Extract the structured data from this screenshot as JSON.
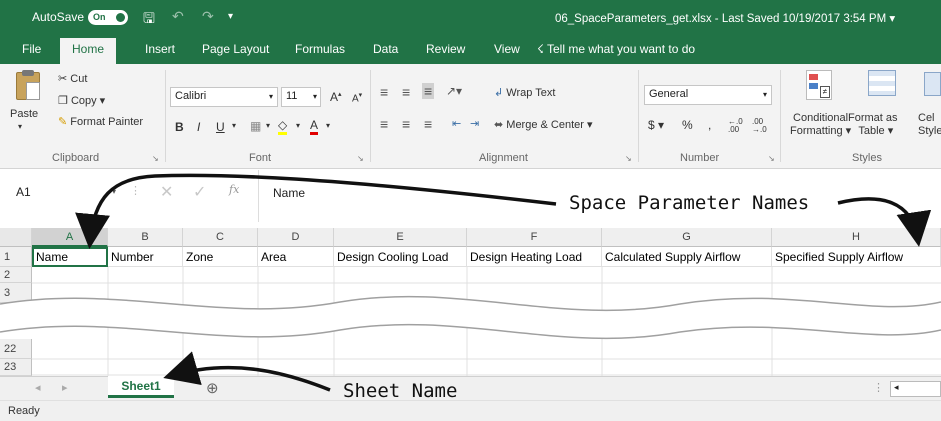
{
  "titlebar": {
    "autosave_label": "AutoSave",
    "autosave_state": "On",
    "file_title": "06_SpaceParameters_get.xlsx  -  Last Saved 10/19/2017 3:54 PM  ▾"
  },
  "tabs": [
    "File",
    "Home",
    "Insert",
    "Page Layout",
    "Formulas",
    "Data",
    "Review",
    "View"
  ],
  "tell_me": "Tell me what you want to do",
  "ribbon": {
    "clipboard": {
      "paste": "Paste",
      "cut": "Cut",
      "copy": "Copy",
      "format_painter": "Format Painter",
      "group": "Clipboard"
    },
    "font": {
      "name": "Calibri",
      "size": "11",
      "group": "Font"
    },
    "alignment": {
      "wrap_text": "Wrap Text",
      "merge_center": "Merge & Center",
      "group": "Alignment"
    },
    "number": {
      "format": "General",
      "currency": "$",
      "percent": "%",
      "comma": ",",
      "group": "Number"
    },
    "styles": {
      "conditional_formatting": [
        "Conditional",
        "Formatting ▾"
      ],
      "format_as_table": [
        "Format as",
        "Table ▾"
      ],
      "cell_styles": [
        "Cel",
        "Style"
      ],
      "group": "Styles"
    }
  },
  "formula_bar": {
    "name_box": "A1",
    "fx": "fx",
    "value": "Name"
  },
  "grid": {
    "columns": [
      "A",
      "B",
      "C",
      "D",
      "E",
      "F",
      "G",
      "H"
    ],
    "row1": [
      "Name",
      "Number",
      "Zone",
      "Area",
      "Design Cooling Load",
      "Design Heating Load",
      "Calculated Supply Airflow",
      "Specified Supply Airflow"
    ],
    "rows": [
      "1",
      "2",
      "3",
      "22",
      "23"
    ]
  },
  "sheet_tab": "Sheet1",
  "status": "Ready",
  "annotations": {
    "columns": "Space Parameter Names",
    "sheet": "Sheet Name"
  },
  "colors": {
    "excel_green": "#217346"
  }
}
